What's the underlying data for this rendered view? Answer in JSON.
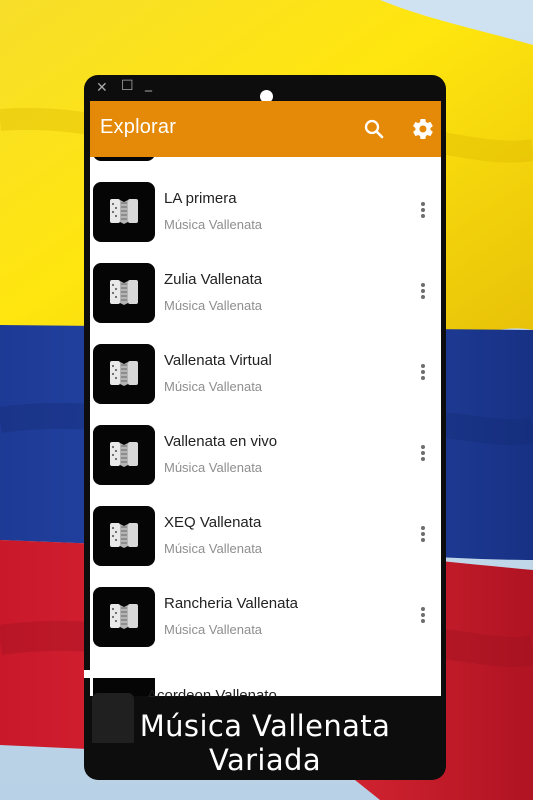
{
  "window_controls": {
    "close_icon": "close-icon",
    "maximize_icon": "maximize-icon",
    "minimize_icon": "minimize-icon"
  },
  "appbar": {
    "title": "Explorar",
    "search_icon": "search-icon",
    "settings_icon": "gear-icon",
    "background": "#e58a08"
  },
  "items": [
    {
      "title": "LA primera",
      "subtitle": "Música Vallenata"
    },
    {
      "title": "Zulia Vallenata",
      "subtitle": "Música Vallenata"
    },
    {
      "title": "Vallenata Virtual",
      "subtitle": "Música Vallenata"
    },
    {
      "title": "Vallenata en vivo",
      "subtitle": "Música Vallenata"
    },
    {
      "title": "XEQ Vallenata",
      "subtitle": "Música Vallenata"
    },
    {
      "title": "Rancheria Vallenata",
      "subtitle": "Música Vallenata"
    }
  ],
  "player": {
    "title": "Acordeon Vallenato"
  },
  "caption": "Música Vallenata Variada",
  "colors": {
    "flag_yellow": "#f5d20a",
    "flag_blue": "#1f3f9c",
    "flag_red": "#cf1f2f"
  }
}
